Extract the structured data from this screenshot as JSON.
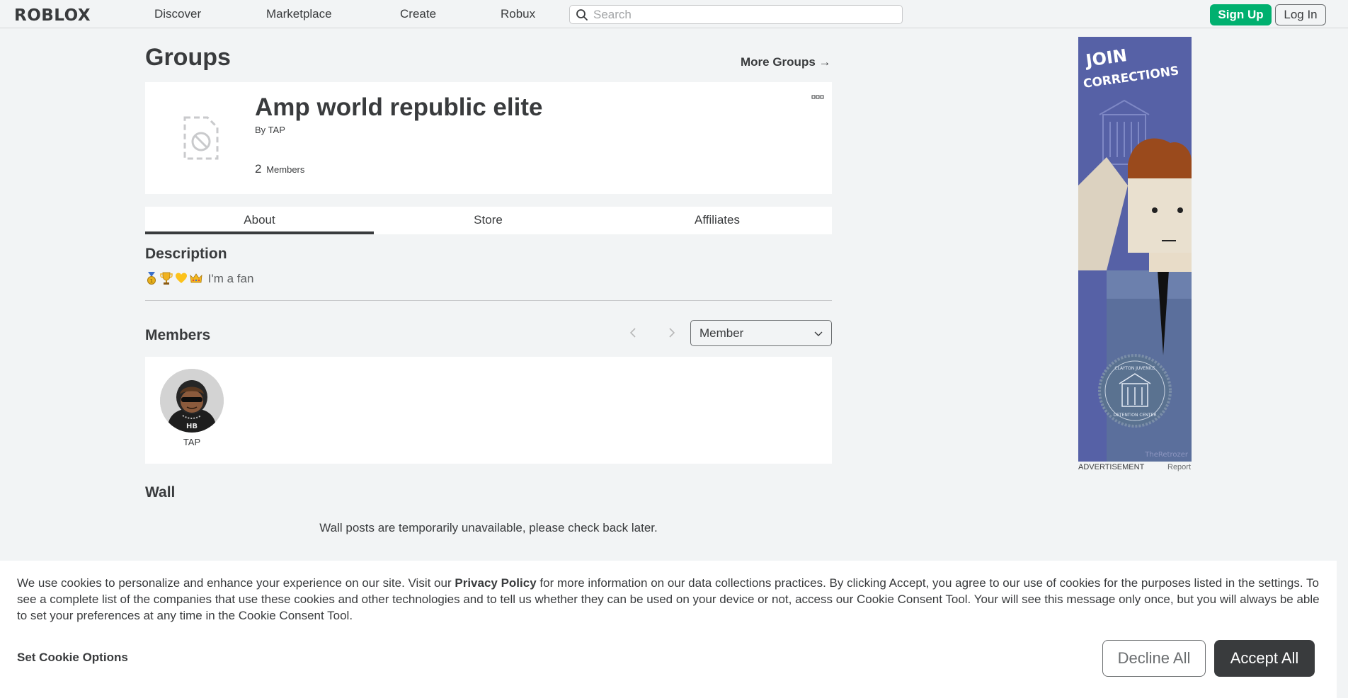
{
  "nav": {
    "logo": "ROBLOX",
    "links": [
      "Discover",
      "Marketplace",
      "Create",
      "Robux"
    ],
    "search_placeholder": "Search",
    "signup_label": "Sign Up",
    "login_label": "Log In"
  },
  "page": {
    "title": "Groups",
    "more_groups": "More Groups →"
  },
  "group": {
    "name": "Amp world republic elite",
    "by_prefix": "By",
    "owner": "TAP",
    "member_count": "2",
    "members_label": "Members"
  },
  "tabs": [
    "About",
    "Store",
    "Affiliates"
  ],
  "description": {
    "title": "Description",
    "text": "I'm a fan",
    "emoji_icons": [
      "medal-icon",
      "trophy-icon",
      "yellow-heart-icon",
      "crown-icon"
    ]
  },
  "members": {
    "title": "Members",
    "role_selected": "Member",
    "list": [
      {
        "name": "TAP"
      }
    ]
  },
  "wall": {
    "title": "Wall",
    "message": "Wall posts are temporarily unavailable, please check back later."
  },
  "ad": {
    "label": "ADVERTISEMENT",
    "report": "Report",
    "headline_1": "JOIN",
    "headline_2": "CORRECTIONS",
    "seal_top": "CLAYTON JUVENILE",
    "seal_bottom": "DETENTION CENTER",
    "credit": "TheRetrozer"
  },
  "cookie": {
    "text_before": "We use cookies to personalize and enhance your experience on our site. Visit our ",
    "privacy_link": "Privacy Policy",
    "text_after": " for more information on our data collections practices. By clicking Accept, you agree to our use of cookies for the purposes listed in the settings. To see a complete list of the companies that use these cookies and other technologies and to tell us whether they can be used on your device or not, access our Cookie Consent Tool. Your will see this message only once, but you will always be able to set your preferences at any time in the Cookie Consent Tool.",
    "options_label": "Set Cookie Options",
    "decline_label": "Decline All",
    "accept_label": "Accept All"
  },
  "colors": {
    "brand_green": "#00b06f",
    "text_dark": "#393b3d",
    "background": "#f2f4f5",
    "ad_background": "#5862a8"
  }
}
